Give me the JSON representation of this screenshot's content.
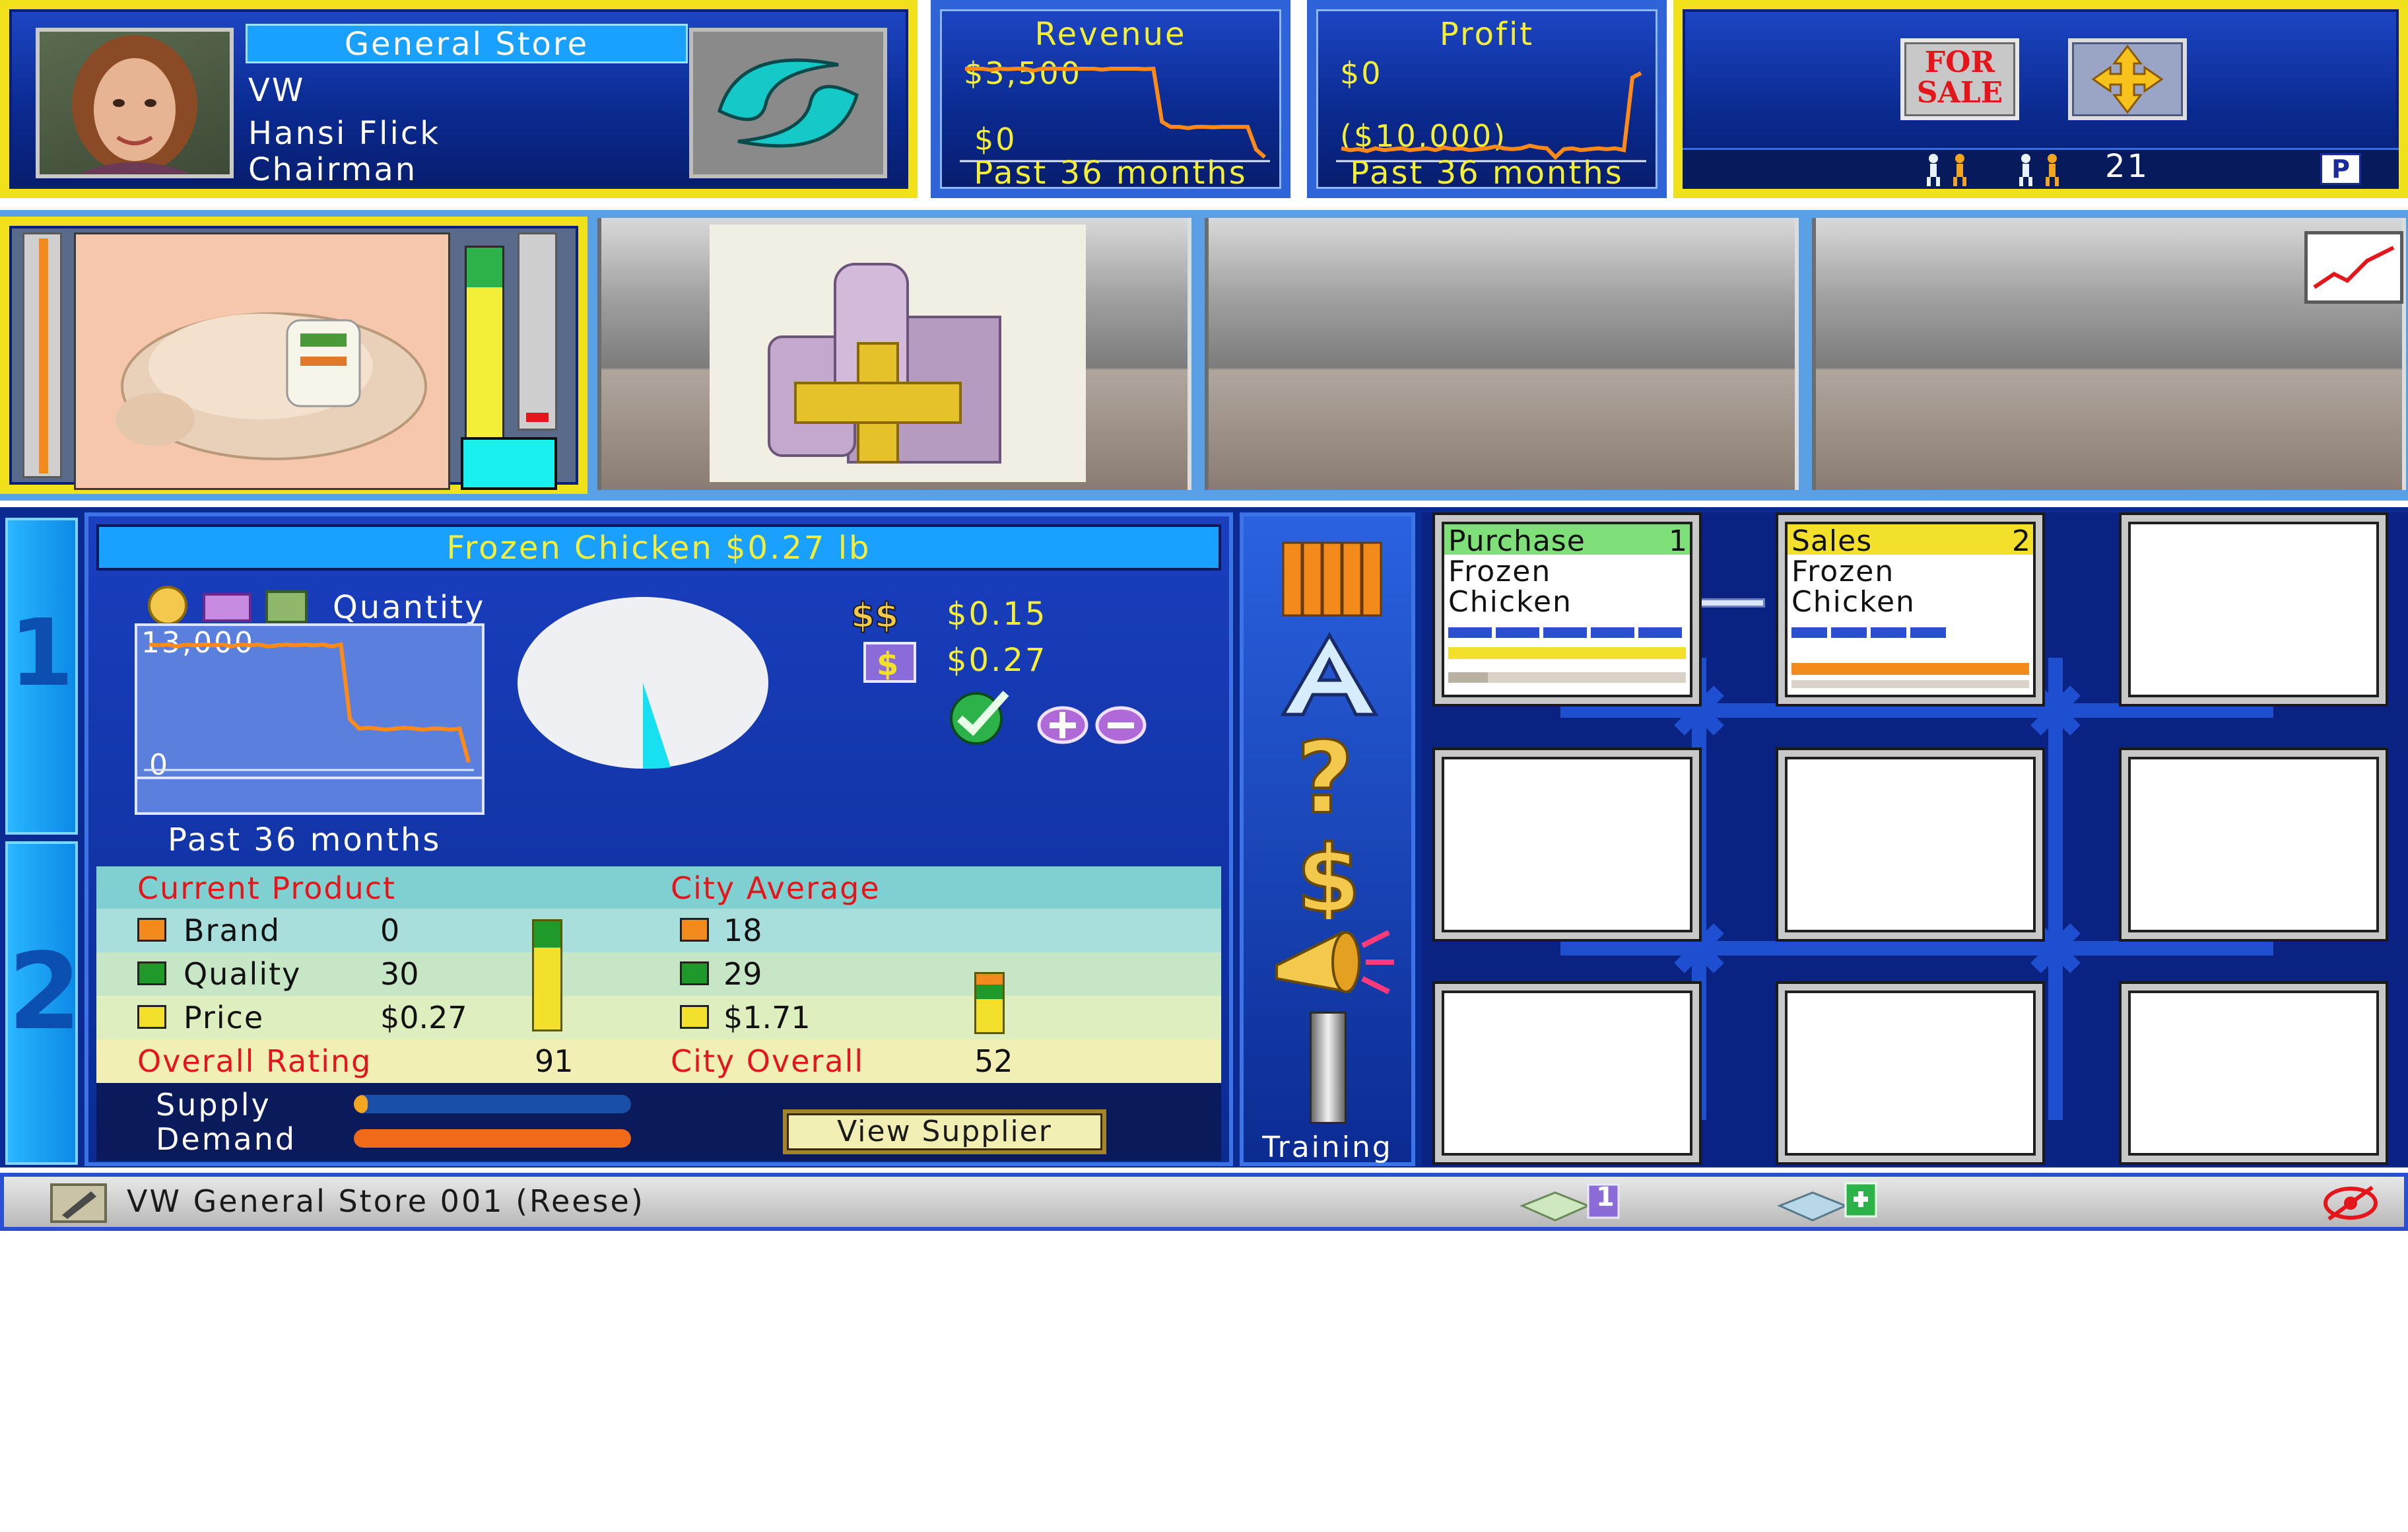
{
  "header": {
    "store_type": "General Store",
    "company": "VW",
    "manager_name": "Hansi Flick",
    "manager_title": "Chairman"
  },
  "revenue": {
    "title": "Revenue",
    "top_label": "$3,500",
    "bottom_label": "$0",
    "period": "Past 36 months"
  },
  "profit": {
    "title": "Profit",
    "top_label": "$0",
    "bottom_label": "($10,000)",
    "period": "Past 36 months"
  },
  "toolbar": {
    "for_sale_label": "FOR SALE",
    "count": "21",
    "parking_label": "P"
  },
  "product": {
    "title": "Frozen Chicken   $0.27 lb",
    "quantity_label": "Quantity",
    "qty_top": "13,000",
    "qty_bottom": "0",
    "period": "Past 36 months",
    "cost": "$0.15",
    "price": "$0.27",
    "view_supplier": "View Supplier"
  },
  "comparison": {
    "current_header": "Current Product",
    "city_header": "City Average",
    "brand_label": "Brand",
    "brand_value": "0",
    "brand_city": "18",
    "quality_label": "Quality",
    "quality_value": "30",
    "quality_city": "29",
    "price_label": "Price",
    "price_value": "$0.27",
    "price_city": "$1.71",
    "overall_label": "Overall Rating",
    "overall_value": "91",
    "city_overall_label": "City Overall",
    "city_overall_value": "52",
    "supply_label": "Supply",
    "demand_label": "Demand",
    "supply_level": 0.05,
    "demand_level": 1.0
  },
  "side_tabs": [
    "1",
    "2"
  ],
  "tools": {
    "training_label": "Training"
  },
  "units": [
    {
      "title": "Purchase",
      "num": "1",
      "line1": "Frozen",
      "line2": "Chicken"
    },
    {
      "title": "Sales",
      "num": "2",
      "line1": "Frozen",
      "line2": "Chicken"
    }
  ],
  "status_bar": {
    "firm_name": "VW General Store 001 (Reese)",
    "badge1": "1"
  },
  "colors": {
    "frame_yellow": "#f1e11a",
    "panel_navy": "#0b2b92",
    "teal_row": "#7fd0d0",
    "cream_row": "#f2efb4",
    "orange_line": "#ff8a1a",
    "red_label": "#e4161b"
  },
  "chart_data": [
    {
      "type": "line",
      "title": "Revenue",
      "xlabel": "Past 36 months",
      "ylim_labels": [
        "$0",
        "$3,500"
      ],
      "values": [
        3500,
        3500,
        3500,
        3450,
        3500,
        3480,
        3500,
        3500,
        3420,
        3500,
        3500,
        3500,
        3480,
        3500,
        3500,
        3500,
        3460,
        3500,
        3500,
        3500,
        3500,
        3480,
        3500,
        1400,
        1200,
        1200,
        1150,
        1200,
        1200,
        1180,
        1200,
        1200,
        1200,
        1200,
        300,
        0
      ]
    },
    {
      "type": "line",
      "title": "Profit",
      "xlabel": "Past 36 months",
      "ylim_labels": [
        "($10,000)",
        "$0"
      ],
      "values": [
        -9000,
        -9200,
        -9100,
        -9300,
        -9000,
        -9200,
        -9100,
        -9000,
        -9200,
        -9100,
        -9000,
        -9200,
        -8900,
        -9100,
        -9000,
        -9200,
        -9100,
        -9000,
        -8800,
        -9000,
        -9100,
        -9000,
        -8700,
        -8900,
        -9000,
        -10000,
        -9100,
        -9000,
        -9200,
        -9100,
        -9000,
        -9100,
        -9000,
        -9200,
        -1000,
        -500
      ]
    },
    {
      "type": "line",
      "title": "Quantity",
      "xlabel": "Past 36 months",
      "ylim_labels": [
        "0",
        "13,000"
      ],
      "values": [
        13000,
        12900,
        13000,
        12800,
        13000,
        12900,
        13000,
        12900,
        13000,
        12800,
        13000,
        12900,
        13000,
        12800,
        12900,
        13000,
        12900,
        13000,
        12900,
        13000,
        12800,
        13000,
        5000,
        4000,
        4100,
        4000,
        3900,
        4000,
        4100,
        4000,
        3900,
        4000,
        4000,
        3900,
        4000,
        400
      ]
    }
  ]
}
